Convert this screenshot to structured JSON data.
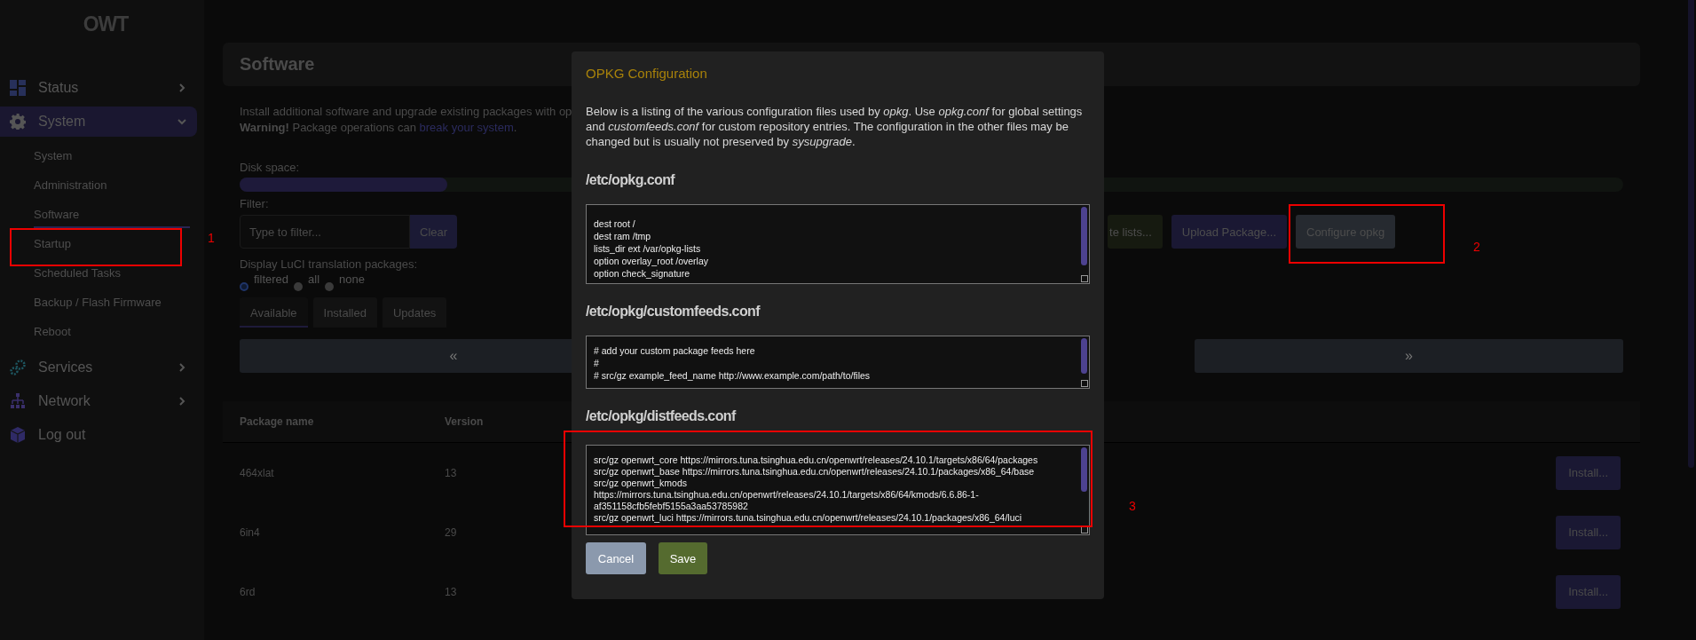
{
  "logo": "OWT",
  "sidebar": {
    "items": [
      {
        "label": "Status",
        "selected": false,
        "expanded": false
      },
      {
        "label": "System",
        "selected": true,
        "expanded": true,
        "children": [
          {
            "label": "System",
            "selected": false
          },
          {
            "label": "Administration",
            "selected": false
          },
          {
            "label": "Software",
            "selected": true
          },
          {
            "label": "Startup",
            "selected": false
          },
          {
            "label": "Scheduled Tasks",
            "selected": false
          },
          {
            "label": "Backup / Flash Firmware",
            "selected": false
          },
          {
            "label": "Reboot",
            "selected": false
          }
        ]
      },
      {
        "label": "Services",
        "selected": false,
        "expanded": false
      },
      {
        "label": "Network",
        "selected": false,
        "expanded": false
      },
      {
        "label": "Log out",
        "selected": false
      }
    ]
  },
  "page": {
    "title": "Software",
    "intro": "Install additional software and upgrade existing packages with op",
    "warning": "**Warning!** Package operations can ",
    "warning_link": "break your system",
    "warning_end": ".",
    "disk_label": "Disk space:",
    "disk": {
      "level": 0.15
    },
    "filter_label": "Filter:",
    "filter": {
      "placeholder": "Type to filter..."
    },
    "clear_button": "Clear",
    "actions": [
      {
        "label": "te lists...",
        "kind": "green"
      },
      {
        "label": "Upload Package...",
        "kind": "purple"
      },
      {
        "label": "Configure opkg",
        "kind": "gray"
      }
    ],
    "translation_label": "Display LuCI translation packages:",
    "translation_options": [
      {
        "label": "filtered",
        "selected": true
      },
      {
        "label": "all",
        "selected": false
      },
      {
        "label": "none",
        "selected": false
      }
    ],
    "tabs": [
      {
        "label": "Available",
        "selected": true
      },
      {
        "label": "Installed",
        "selected": false
      },
      {
        "label": "Updates",
        "selected": false
      }
    ],
    "pager": {
      "prev": "«",
      "next": "»"
    },
    "table": {
      "columns": [
        "Package name",
        "Version"
      ],
      "rows": [
        {
          "name": "464xlat",
          "version": "13",
          "action": "Install..."
        },
        {
          "name": "6in4",
          "version": "29",
          "action": "Install..."
        },
        {
          "name": "6rd",
          "version": "13",
          "action": "Install..."
        }
      ]
    }
  },
  "dialog": {
    "title": "OPKG Configuration",
    "description": "Below is a listing of the various configuration files used by *opkg*. Use *opkg.conf* for global settings and *customfeeds.conf* for custom repository entries. The configuration in the other files may be changed but is usually not preserved by *sysupgrade*.",
    "files": [
      {
        "name": "/etc/opkg.conf",
        "lines": [
          "dest root /",
          "dest ram /tmp",
          "lists_dir ext /var/opkg-lists",
          "option overlay_root /overlay",
          "option check_signature"
        ]
      },
      {
        "name": "/etc/opkg/customfeeds.conf",
        "lines": [
          "# add your custom package feeds here",
          "#",
          "# src/gz example_feed_name http://www.example.com/path/to/files"
        ]
      },
      {
        "name": "/etc/opkg/distfeeds.conf",
        "lines": [
          "src/gz openwrt_core https://mirrors.tuna.tsinghua.edu.cn/openwrt/releases/24.10.1/targets/x86/64/packages",
          "src/gz openwrt_base https://mirrors.tuna.tsinghua.edu.cn/openwrt/releases/24.10.1/packages/x86_64/base",
          "src/gz openwrt_kmods",
          "https://mirrors.tuna.tsinghua.edu.cn/openwrt/releases/24.10.1/targets/x86/64/kmods/6.6.86-1-",
          "af351158cfb5febf5155a3aa53785982",
          "src/gz openwrt_luci https://mirrors.tuna.tsinghua.edu.cn/openwrt/releases/24.10.1/packages/x86_64/luci"
        ]
      }
    ],
    "buttons": [
      {
        "label": "Cancel",
        "kind": "cancel"
      },
      {
        "label": "Save",
        "kind": "save"
      }
    ]
  },
  "annotations": [
    {
      "label": "1"
    },
    {
      "label": "2"
    },
    {
      "label": "3"
    }
  ]
}
